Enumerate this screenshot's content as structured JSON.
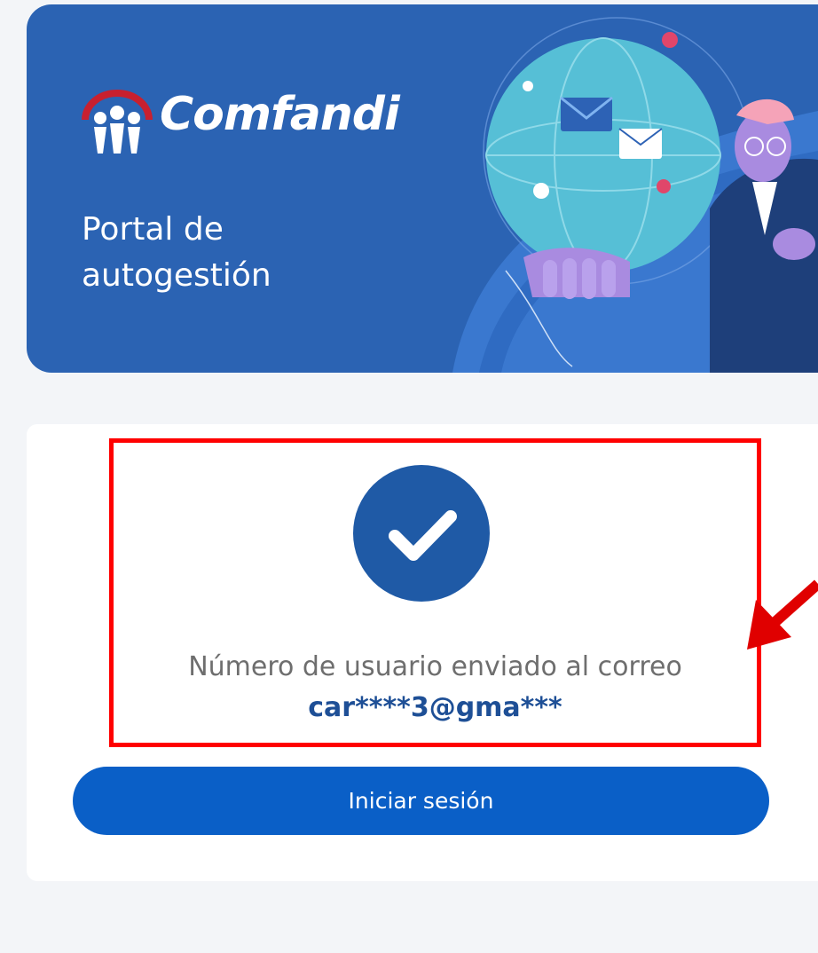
{
  "brand": {
    "name": "Comfandi",
    "portal_title": "Portal de autogestión"
  },
  "confirmation": {
    "icon": "check-circle-icon",
    "message": "Número de usuario enviado al correo",
    "masked_email": "car****3@gma***"
  },
  "actions": {
    "login_label": "Iniciar sesión"
  },
  "colors": {
    "banner": "#2b63b3",
    "success_icon": "#1f5aa6",
    "button": "#0a5fc7",
    "email_text": "#1e4f96",
    "annotation": "#ff0000"
  }
}
